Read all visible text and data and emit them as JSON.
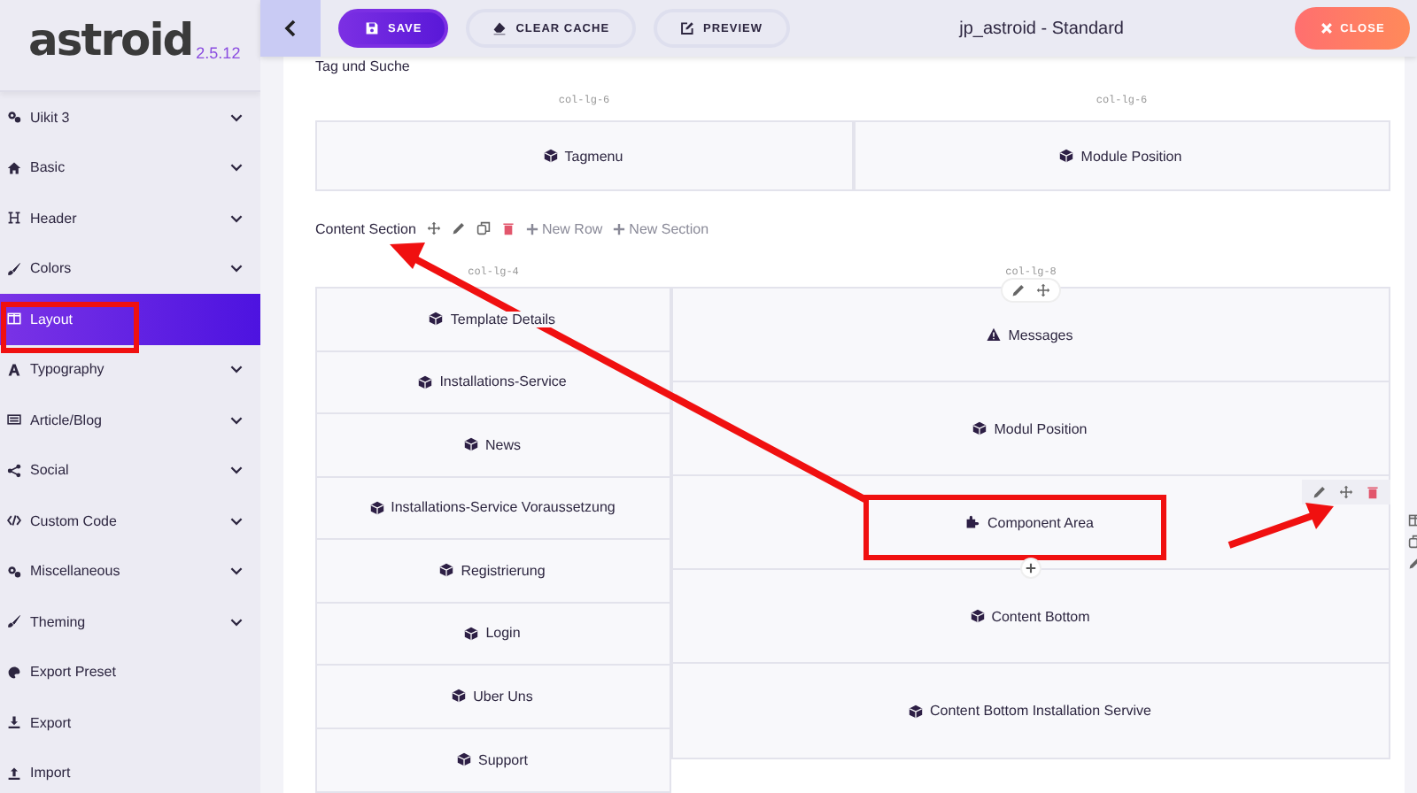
{
  "sidebar": {
    "logo": "astroid",
    "version": "2.5.12",
    "items": [
      {
        "label": "Uikit 3",
        "expandable": true,
        "selected": false
      },
      {
        "label": "Basic",
        "expandable": true,
        "selected": false
      },
      {
        "label": "Header",
        "expandable": true,
        "selected": false
      },
      {
        "label": "Colors",
        "expandable": true,
        "selected": false
      },
      {
        "label": "Layout",
        "expandable": false,
        "selected": true
      },
      {
        "label": "Typography",
        "expandable": true,
        "selected": false
      },
      {
        "label": "Article/Blog",
        "expandable": true,
        "selected": false
      },
      {
        "label": "Social",
        "expandable": true,
        "selected": false
      },
      {
        "label": "Custom Code",
        "expandable": true,
        "selected": false
      },
      {
        "label": "Miscellaneous",
        "expandable": true,
        "selected": false
      },
      {
        "label": "Theming",
        "expandable": true,
        "selected": false
      },
      {
        "label": "Export Preset",
        "expandable": false,
        "selected": false
      },
      {
        "label": "Export",
        "expandable": false,
        "selected": false
      },
      {
        "label": "Import",
        "expandable": false,
        "selected": false
      }
    ]
  },
  "toolbar": {
    "buttons": [
      {
        "kind": "save",
        "label": "SAVE"
      },
      {
        "kind": "cache",
        "label": "CLEAR CACHE"
      },
      {
        "kind": "preview",
        "label": "PREVIEW"
      }
    ],
    "title": "jp_astroid - Standard",
    "close": "CLOSE"
  },
  "sections": [
    {
      "title": "Tag und Suche",
      "columns": [
        {
          "size": "col-lg-6",
          "elements": [
            {
              "kind": "module",
              "label": "Tagmenu"
            }
          ]
        },
        {
          "size": "col-lg-6",
          "elements": [
            {
              "kind": "module",
              "label": "Module Position"
            }
          ]
        }
      ]
    },
    {
      "title": "Content Section",
      "actions": [
        "New Row",
        "New Section"
      ],
      "columns": [
        {
          "size": "col-lg-4",
          "elements": [
            {
              "kind": "module",
              "label": "Template Details"
            },
            {
              "kind": "module",
              "label": "Installations-Service"
            },
            {
              "kind": "module",
              "label": "News"
            },
            {
              "kind": "module",
              "label": "Installations-Service Voraussetzung"
            },
            {
              "kind": "module",
              "label": "Registrierung"
            },
            {
              "kind": "module",
              "label": "Login"
            },
            {
              "kind": "module",
              "label": "Uber Uns"
            },
            {
              "kind": "module",
              "label": "Support"
            }
          ]
        },
        {
          "size": "col-lg-8",
          "elements": [
            {
              "kind": "message",
              "label": "Messages"
            },
            {
              "kind": "module",
              "label": "Modul Position"
            },
            {
              "kind": "component",
              "label": "Component Area"
            },
            {
              "kind": "module",
              "label": "Content Bottom"
            },
            {
              "kind": "module",
              "label": "Content Bottom Installation Servive"
            }
          ]
        }
      ]
    }
  ]
}
